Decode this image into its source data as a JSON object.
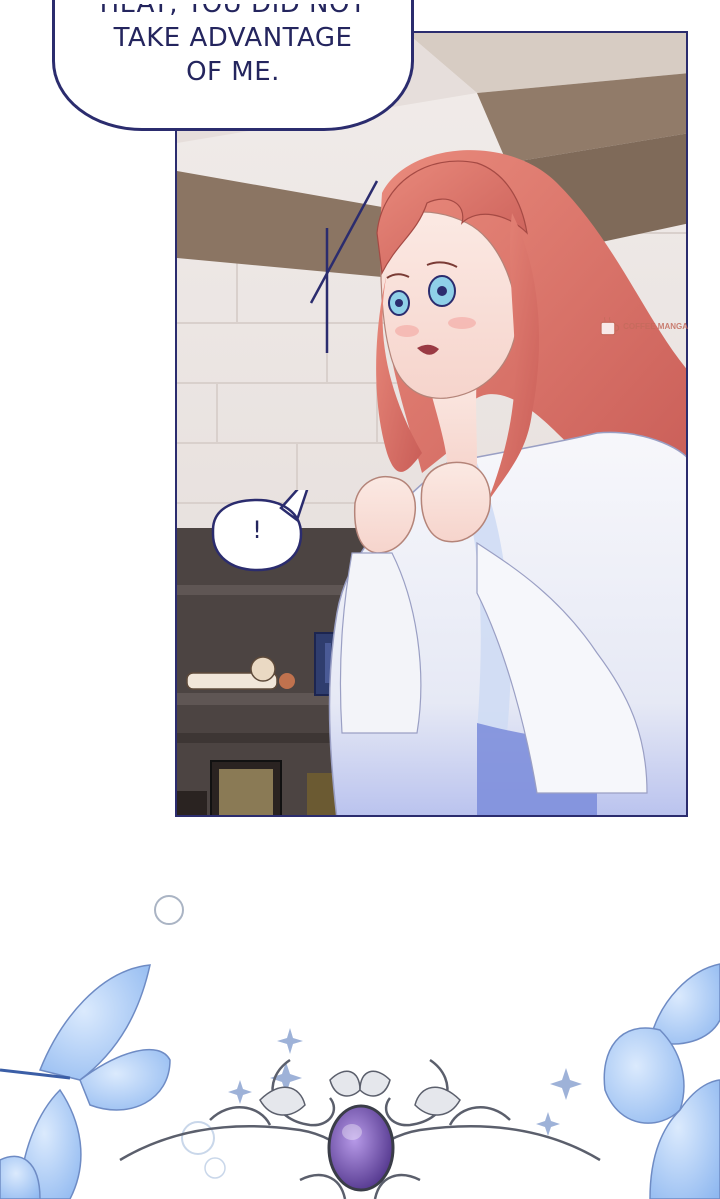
{
  "speech_top": {
    "line1": "HEAT, YOU DID NOT",
    "line2": "TAKE ADVANTAGE",
    "line3": "OF ME."
  },
  "speech_small": {
    "text": "!"
  },
  "watermark": {
    "text": "COFFEE MANGA"
  },
  "colors": {
    "ink": "#24255e",
    "hair": "#e07a70",
    "robe": "#f4f5fa",
    "sash": "#7a8ee0",
    "wall": "#e9e3e1",
    "beam": "#8a7462",
    "shelf": "#4e4644",
    "gem": "#6a4fa8",
    "flower": "#9cc3f3"
  }
}
